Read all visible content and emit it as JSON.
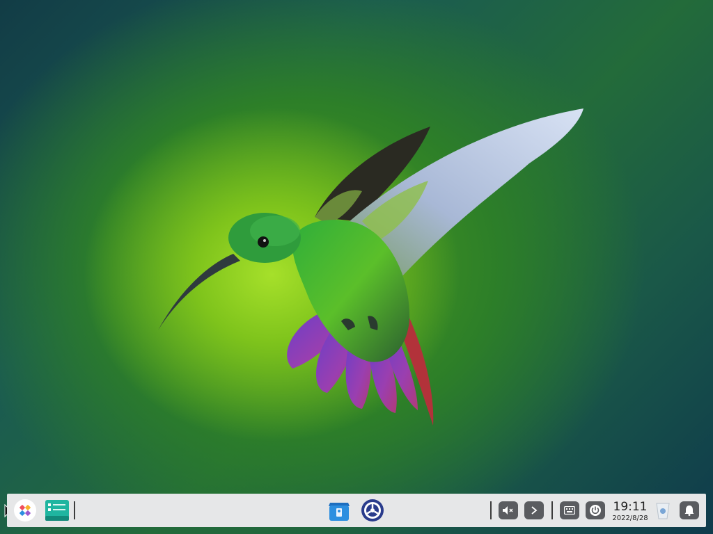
{
  "desktop": {
    "wallpaper": "hummingbird-wallpaper"
  },
  "taskbar": {
    "start_icon": "launcher-icon",
    "pinned_apps": [
      {
        "name": "multitasking-view-icon"
      },
      {
        "name": "app-store-icon"
      },
      {
        "name": "control-center-icon"
      }
    ],
    "tray": {
      "volume_icon": "volume-muted-icon",
      "expand_icon": "chevron-right-icon",
      "keyboard_icon": "keyboard-icon",
      "power_icon": "power-icon",
      "trash_icon": "trash-icon",
      "notification_icon": "bell-icon"
    },
    "clock": {
      "time": "19:11",
      "date": "2022/8/28"
    }
  },
  "colors": {
    "taskbar_bg": "#e6e7e8",
    "tray_button_bg": "#5a5c60",
    "accent_blue": "#2c8fe0",
    "teal": "#1fb5a0"
  }
}
